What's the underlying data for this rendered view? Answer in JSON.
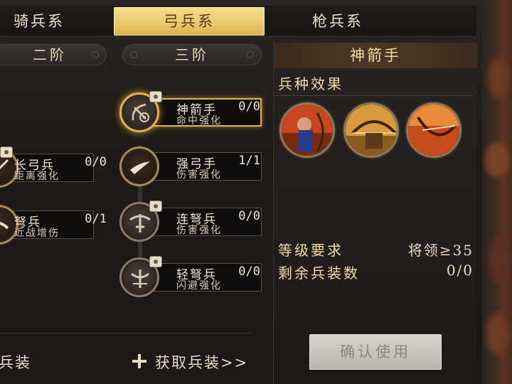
{
  "tabs": [
    {
      "label": "骑兵系",
      "active": false
    },
    {
      "label": "弓兵系",
      "active": true
    },
    {
      "label": "枪兵系",
      "active": false
    }
  ],
  "tiers": {
    "tier2": "二阶",
    "tier3": "三阶"
  },
  "nodes": {
    "longbow": {
      "name": "长弓兵",
      "count": "0/0",
      "desc": "距离强化"
    },
    "crossbow": {
      "name": "弩兵",
      "count": "0/1",
      "desc": "近战增伤"
    },
    "marksman": {
      "name": "神箭手",
      "count": "0/0",
      "desc": "命中强化"
    },
    "strongbow": {
      "name": "强弓手",
      "count": "1/1",
      "desc": "伤害强化"
    },
    "repeater": {
      "name": "连弩兵",
      "count": "0/0",
      "desc": "伤害强化"
    },
    "lightxbow": {
      "name": "轻弩兵",
      "count": "0/0",
      "desc": "闪避强化"
    }
  },
  "footer": {
    "left_text": "兵装",
    "acquire_link": "获取兵装>>"
  },
  "detail": {
    "title": "神箭手",
    "effect_heading": "兵种效果",
    "level_label": "等级要求",
    "level_value": "将领≥35",
    "remain_label": "剩余兵装数",
    "remain_value": "0/0",
    "confirm_label": "确认使用"
  },
  "colors": {
    "accent": "#e9c86a",
    "selected_border": "#e6b44a"
  }
}
